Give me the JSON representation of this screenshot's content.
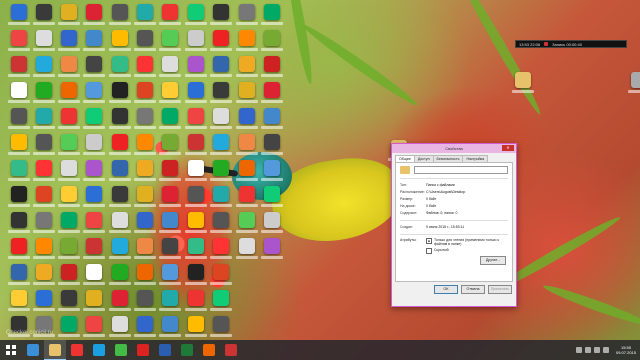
{
  "desktop": {
    "icon_colors": [
      "#2b6fd6",
      "#3a3a3a",
      "#e0b020",
      "#d23",
      "#555",
      "#2aa",
      "#e33",
      "#1c7",
      "#333",
      "#777",
      "#0a6",
      "#e44",
      "#ddd",
      "#36c",
      "#48c",
      "#fb0",
      "#555",
      "#5c5",
      "#ccc",
      "#e22",
      "#f80",
      "#7a3",
      "#c33",
      "#2ad",
      "#e84",
      "#444",
      "#3b8",
      "#f33",
      "#ddd",
      "#a5c",
      "#36a",
      "#ea2",
      "#c22",
      "#fff",
      "#2a2",
      "#e60",
      "#59d",
      "#222",
      "#d42",
      "#fc3"
    ],
    "watermark": "Checkei.conicii.ru"
  },
  "widget": {
    "label_left": "13:53 22:06",
    "label_right": "Запись 00:00:40"
  },
  "dialog": {
    "title": "Свойства",
    "close_glyph": "✕",
    "tabs": [
      "Общие",
      "Доступ",
      "Безопасность",
      "Настройка"
    ],
    "folder_name": "",
    "rows": [
      {
        "k": "Тип:",
        "v": "Папка с файлами"
      },
      {
        "k": "Расположение:",
        "v": "C:\\Users\\August\\Desktop"
      },
      {
        "k": "Размер:",
        "v": "0 байт"
      },
      {
        "k": "На диске:",
        "v": "0 байт"
      },
      {
        "k": "Содержит:",
        "v": "Файлов: 0; папок: 0"
      }
    ],
    "created": {
      "k": "Создан:",
      "v": "9 июля 2015 г., 15:53:11"
    },
    "attributes_label": "Атрибуты:",
    "attr_readonly": "Только для чтения (применимо только к файлам в папке)",
    "attr_hidden": "Скрытый",
    "other_button": "Другие...",
    "buttons": {
      "ok": "ОК",
      "cancel": "Отмена",
      "apply": "Применить"
    }
  },
  "taskbar": {
    "apps": [
      {
        "name": "ie",
        "color": "#3a8fd6"
      },
      {
        "name": "explorer",
        "color": "#e8c26a",
        "active": true
      },
      {
        "name": "chrome",
        "color": "#e33"
      },
      {
        "name": "skype",
        "color": "#1aa0e0"
      },
      {
        "name": "utorrent",
        "color": "#4b4"
      },
      {
        "name": "opera",
        "color": "#d22"
      },
      {
        "name": "word",
        "color": "#2b5eb0"
      },
      {
        "name": "excel",
        "color": "#1f7a3a"
      },
      {
        "name": "media",
        "color": "#e60"
      },
      {
        "name": "recorder",
        "color": "#c33"
      }
    ],
    "clock_time": "15:55",
    "clock_date": "09.07.2015"
  }
}
